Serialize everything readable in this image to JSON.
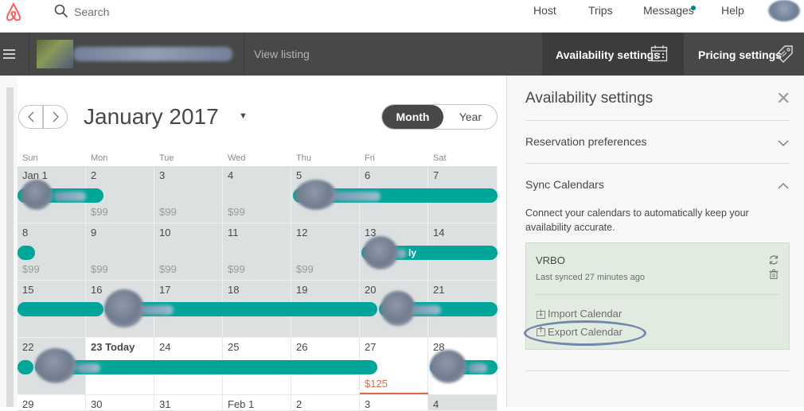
{
  "nav": {
    "search_placeholder": "Search",
    "links": [
      "Host",
      "Trips",
      "Messages",
      "Help"
    ]
  },
  "listing_bar": {
    "view_listing": "View listing",
    "availability_tab": "Availability settings",
    "pricing_tab": "Pricing settings"
  },
  "calendar": {
    "month_title": "January 2017",
    "view_toggle": {
      "month": "Month",
      "year": "Year"
    },
    "weekdays": [
      "Sun",
      "Mon",
      "Tue",
      "Wed",
      "Thu",
      "Fri",
      "Sat"
    ],
    "days": [
      {
        "label": "Jan 1",
        "price": "",
        "blocked": true
      },
      {
        "label": "2",
        "price": "$99",
        "blocked": true
      },
      {
        "label": "3",
        "price": "$99",
        "blocked": true
      },
      {
        "label": "4",
        "price": "$99",
        "blocked": true
      },
      {
        "label": "5",
        "price": "",
        "blocked": true
      },
      {
        "label": "6",
        "price": "",
        "blocked": true
      },
      {
        "label": "7",
        "price": "",
        "blocked": true
      },
      {
        "label": "8",
        "price": "$99",
        "blocked": true
      },
      {
        "label": "9",
        "price": "$99",
        "blocked": true
      },
      {
        "label": "10",
        "price": "$99",
        "blocked": true
      },
      {
        "label": "11",
        "price": "$99",
        "blocked": true
      },
      {
        "label": "12",
        "price": "$99",
        "blocked": true
      },
      {
        "label": "13",
        "price": "",
        "blocked": true
      },
      {
        "label": "14",
        "price": "",
        "blocked": true
      },
      {
        "label": "15",
        "price": "",
        "blocked": true
      },
      {
        "label": "16",
        "price": "",
        "blocked": true
      },
      {
        "label": "17",
        "price": "",
        "blocked": true
      },
      {
        "label": "18",
        "price": "",
        "blocked": true
      },
      {
        "label": "19",
        "price": "",
        "blocked": true
      },
      {
        "label": "20",
        "price": "",
        "blocked": true
      },
      {
        "label": "21",
        "price": "",
        "blocked": true
      },
      {
        "label": "22",
        "price": "",
        "blocked": true
      },
      {
        "label": "23 Today",
        "price": "",
        "blocked": false
      },
      {
        "label": "24",
        "price": "",
        "blocked": false
      },
      {
        "label": "25",
        "price": "",
        "blocked": false
      },
      {
        "label": "26",
        "price": "",
        "blocked": false
      },
      {
        "label": "27",
        "price": "$125",
        "blocked": false
      },
      {
        "label": "28",
        "price": "",
        "blocked": false
      },
      {
        "label": "29",
        "price": "",
        "blocked": false
      },
      {
        "label": "30",
        "price": "",
        "blocked": false
      },
      {
        "label": "31",
        "price": "",
        "blocked": false
      },
      {
        "label": "Feb 1",
        "price": "",
        "blocked": false
      },
      {
        "label": "2",
        "price": "",
        "blocked": false
      },
      {
        "label": "3",
        "price": "",
        "blocked": false
      },
      {
        "label": "4",
        "price": "",
        "blocked": true
      }
    ],
    "guest_fragment": "ly"
  },
  "panel": {
    "title": "Availability settings",
    "reservation_preferences": "Reservation preferences",
    "sync_calendars": "Sync Calendars",
    "sync_description": "Connect your calendars to automatically keep your availability accurate.",
    "vrbo": {
      "name": "VRBO",
      "last_synced": "Last synced 27 minutes ago",
      "import": "Import Calendar",
      "export": "Export Calendar"
    }
  },
  "colors": {
    "teal": "#00a699",
    "dark": "#484848",
    "price_highlight": "#e0674a",
    "annotation": "#7288aa"
  }
}
